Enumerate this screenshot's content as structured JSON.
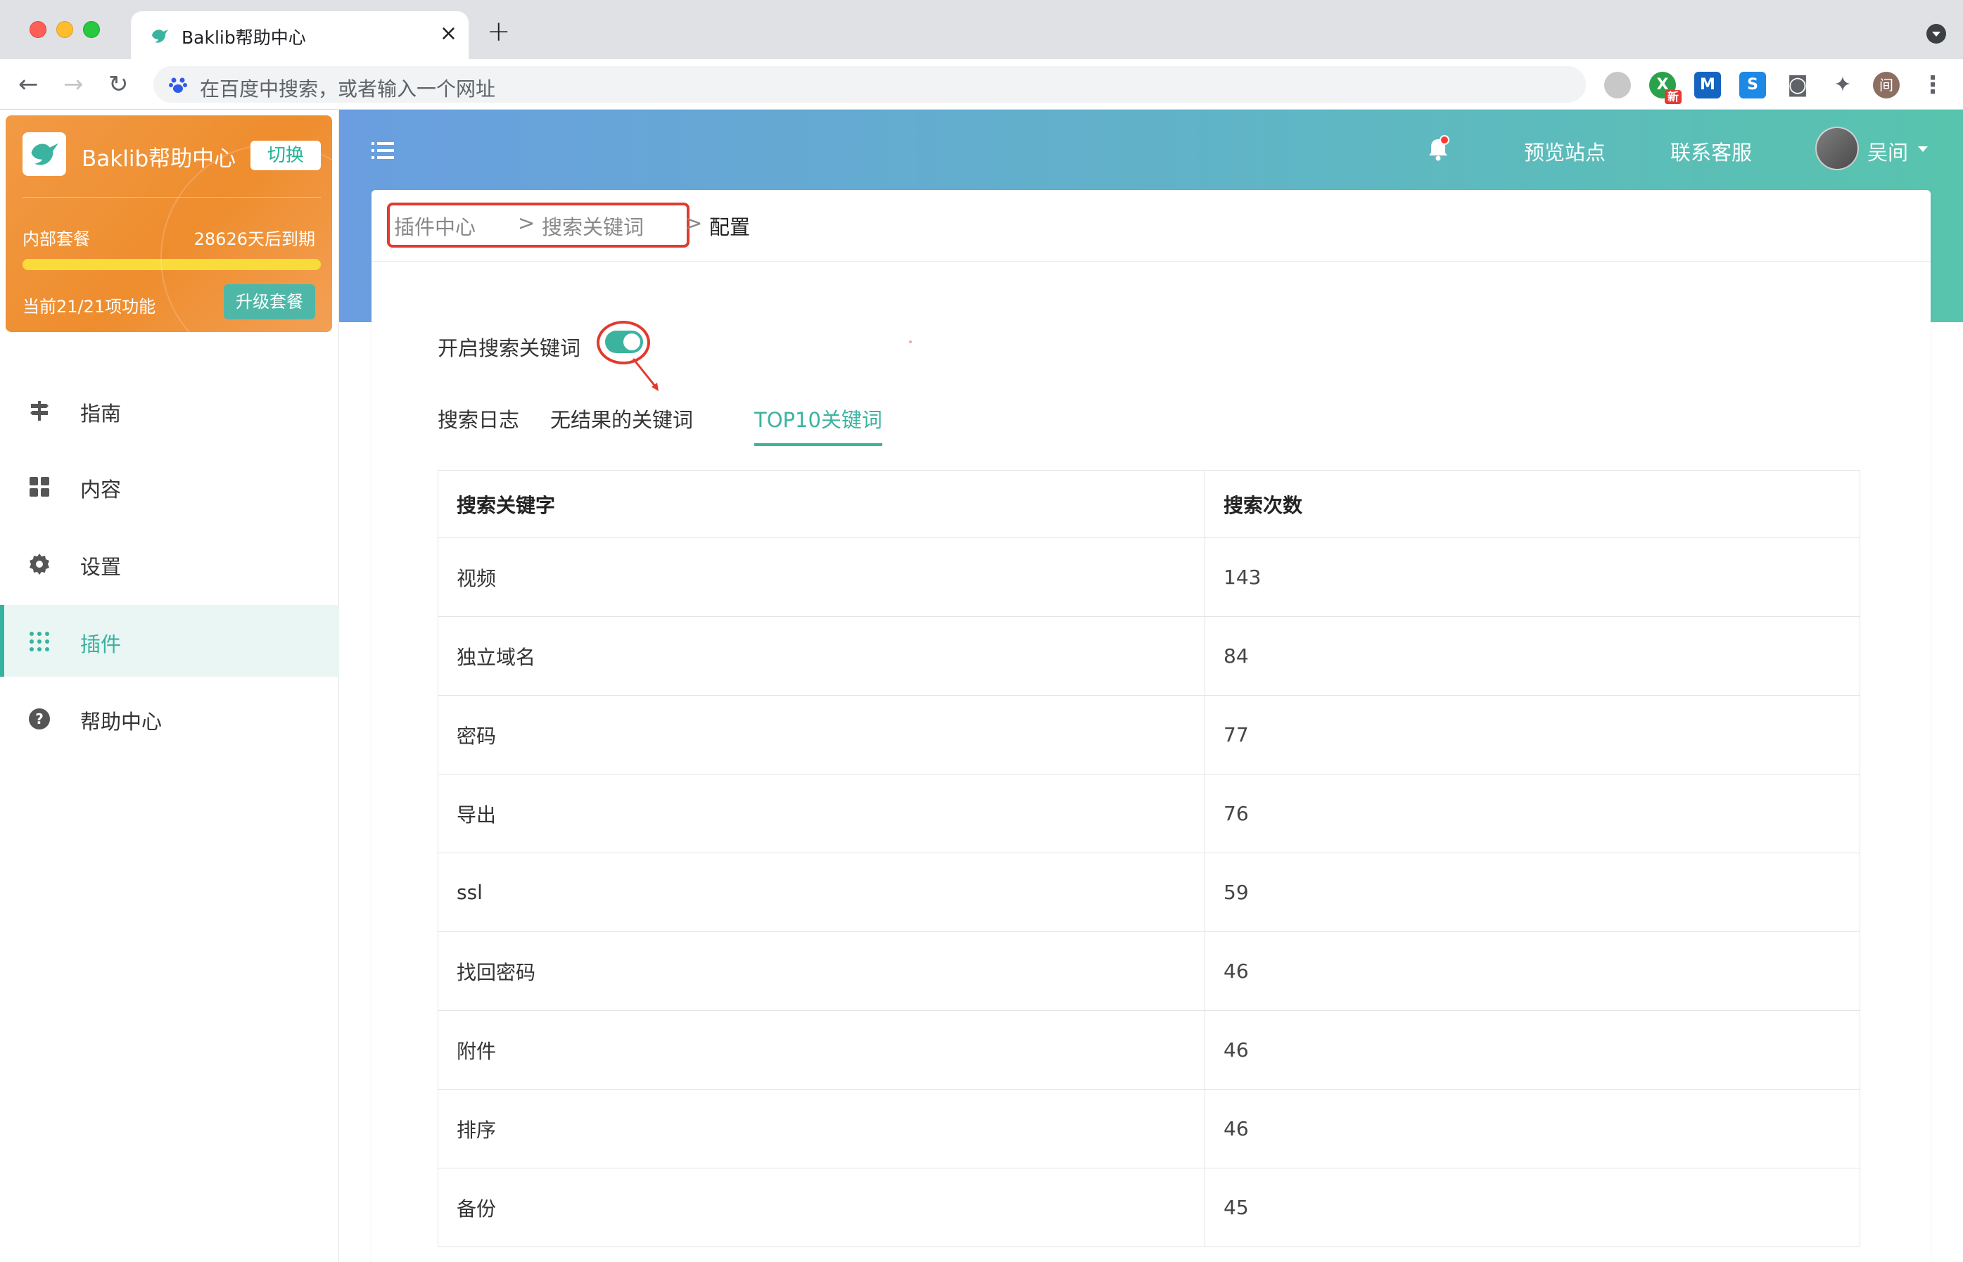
{
  "browser": {
    "tab_title": "Baklib帮助中心",
    "tab_close": "×",
    "new_tab": "+",
    "address_placeholder": "在百度中搜索，或者输入一个网址",
    "ext_badge": "新",
    "ext_m": "M",
    "ext_s": "S",
    "profile_initial": "间"
  },
  "sidebar": {
    "site_name": "Baklib帮助中心",
    "switch_label": "切换",
    "plan_name": "内部套餐",
    "plan_expire": "28626天后到期",
    "plan_progress": 1.0,
    "plan_features": "当前21/21项功能",
    "upgrade_label": "升级套餐",
    "items": [
      {
        "label": "指南",
        "icon": "signpost-icon"
      },
      {
        "label": "内容",
        "icon": "grid-icon"
      },
      {
        "label": "设置",
        "icon": "gear-icon"
      },
      {
        "label": "插件",
        "icon": "apps-dots-icon",
        "active": true
      },
      {
        "label": "帮助中心",
        "icon": "question-circle-icon"
      }
    ]
  },
  "header": {
    "preview_label": "预览站点",
    "contact_label": "联系客服",
    "user_name": "吴间"
  },
  "breadcrumb": {
    "items": [
      "插件中心",
      "搜索关键词",
      "配置"
    ],
    "separator": ">"
  },
  "settings": {
    "toggle_label": "开启搜索关键词",
    "toggle_on": true
  },
  "tabs": [
    "搜索日志",
    "无结果的关键词",
    "TOP10关键词"
  ],
  "active_tab": "TOP10关键词",
  "table": {
    "headers": [
      "搜索关键字",
      "搜索次数"
    ],
    "rows": [
      [
        "视频",
        "143"
      ],
      [
        "独立域名",
        "84"
      ],
      [
        "密码",
        "77"
      ],
      [
        "导出",
        "76"
      ],
      [
        "ssl",
        "59"
      ],
      [
        "找回密码",
        "46"
      ],
      [
        "附件",
        "46"
      ],
      [
        "排序",
        "46"
      ],
      [
        "备份",
        "45"
      ]
    ]
  },
  "colors": {
    "accent": "#3bb39f",
    "plan_card": "#f0953a",
    "annotation_red": "#e23a2e"
  }
}
